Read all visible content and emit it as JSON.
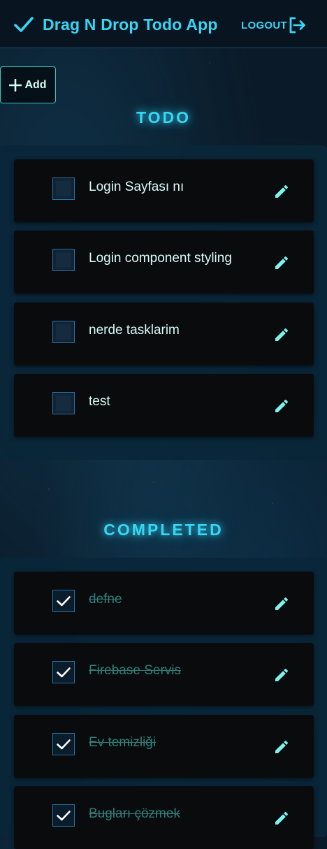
{
  "app": {
    "title": "Drag N Drop Todo App",
    "logout_label": "LOGOUT",
    "add_label": "Add"
  },
  "sections": {
    "todo_title": "TODO",
    "completed_title": "COMPLETED"
  },
  "todo_items": [
    {
      "text": "Login Sayfası nı",
      "completed": false
    },
    {
      "text": "Login component styling",
      "completed": false
    },
    {
      "text": "nerde tasklarim",
      "completed": false
    },
    {
      "text": "test",
      "completed": false
    }
  ],
  "completed_items": [
    {
      "text": "defne",
      "completed": true
    },
    {
      "text": "Firebase Servis",
      "completed": true
    },
    {
      "text": "Ev temizliği",
      "completed": true
    },
    {
      "text": "Bugları çözmek",
      "completed": true
    }
  ],
  "icons": {
    "brand": "check-icon",
    "logout": "logout-icon",
    "add": "plus-icon",
    "edit": "pencil-icon"
  },
  "colors": {
    "accent": "#36d6f5",
    "edit_icon": "#7ff3ee",
    "completed_text": "#2d7f7a"
  }
}
